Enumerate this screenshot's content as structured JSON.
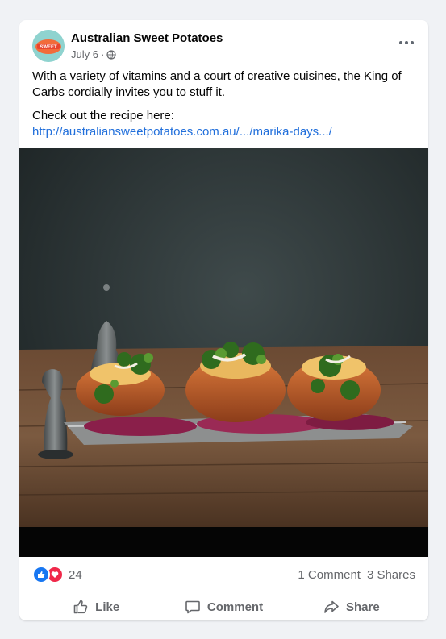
{
  "post": {
    "author": "Australian Sweet Potatoes",
    "date": "July 6",
    "separator": "·",
    "privacy_icon": "globe-icon",
    "avatar_text": "SWEET"
  },
  "content": {
    "paragraph1": "With a variety of vitamins and a court of creative cuisines, the King of Carbs cordially invites you to stuff it.",
    "paragraph2": "Check out the recipe here:",
    "link": "http://australiansweetpotatoes.com.au/.../marika-days.../"
  },
  "stats": {
    "reactions": [
      "like-icon",
      "love-icon"
    ],
    "reaction_count": "24",
    "comments": "1 Comment",
    "shares": "3 Shares"
  },
  "actions": {
    "like": "Like",
    "comment": "Comment",
    "share": "Share"
  },
  "colors": {
    "link": "#216fdb",
    "like_blue": "#1877f2",
    "love_red": "#f0284a",
    "secondary_text": "#65676b"
  }
}
